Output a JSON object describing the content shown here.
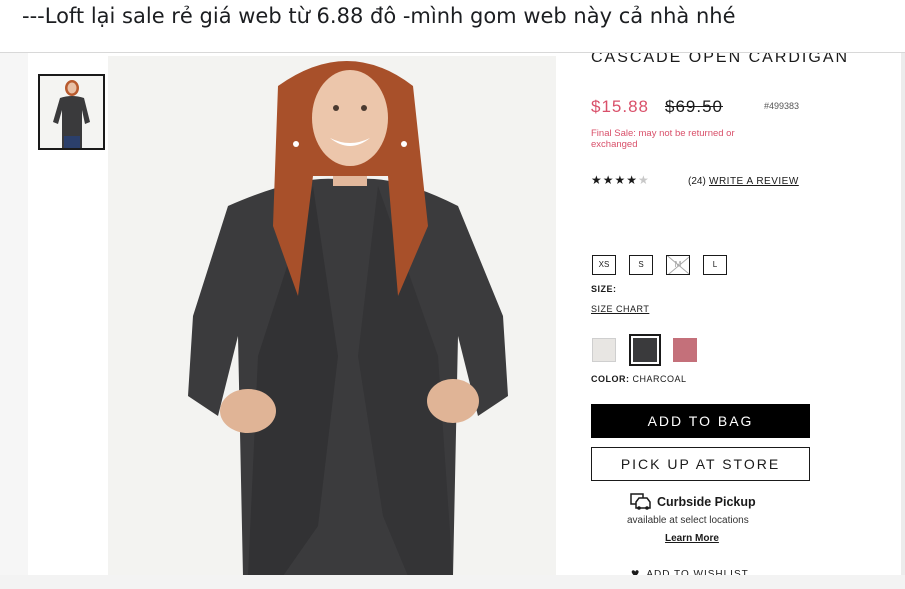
{
  "post": {
    "text": "---Loft lại sale rẻ giá web từ 6.88 đô -mình gom web này cả nhà nhé"
  },
  "product": {
    "title": "CASCADE OPEN CARDIGAN",
    "sale_price": "$15.88",
    "original_price": "$69.50",
    "sku": "#499383",
    "final_sale_note": "Final Sale: may not be returned or exchanged",
    "rating": 4,
    "rating_max": 5,
    "review_count": "(24)",
    "write_review": "WRITE A REVIEW",
    "sizes": [
      {
        "label": "XS",
        "available": true
      },
      {
        "label": "S",
        "available": true
      },
      {
        "label": "M",
        "available": false
      },
      {
        "label": "L",
        "available": true
      }
    ],
    "size_label": "SIZE:",
    "size_chart": "SIZE CHART",
    "colors": [
      {
        "name": "light gray",
        "hex": "#e8e6e3",
        "selected": false
      },
      {
        "name": "charcoal",
        "hex": "#3a3a3c",
        "selected": true
      },
      {
        "name": "rose",
        "hex": "#c4707a",
        "selected": false
      }
    ],
    "color_label": "COLOR:",
    "color_value": "CHARCOAL",
    "add_to_bag": "ADD TO BAG",
    "pick_up": "PICK UP AT STORE",
    "curbside_title": "Curbside Pickup",
    "curbside_sub": "available at select locations",
    "learn_more": "Learn More",
    "wishlist": "ADD TO WISHLIST"
  },
  "icons": {
    "thumbnail": "product-thumbnail-image",
    "main_photo": "model-wearing-cardigan-image",
    "curbside": "car-store-icon",
    "wishlist": "heart-icon"
  }
}
